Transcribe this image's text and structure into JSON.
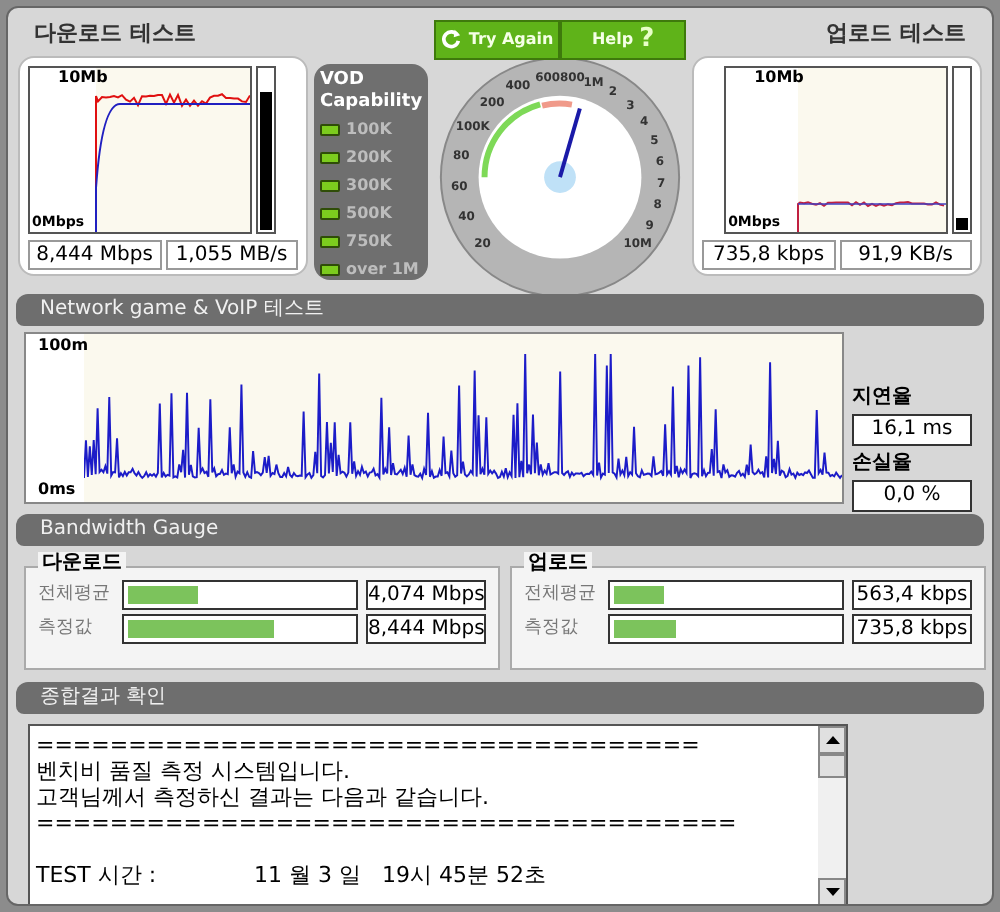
{
  "download": {
    "title": "다운로드 테스트",
    "chart_top": "10Mb",
    "chart_bottom": "0Mbps",
    "level": 0.86,
    "speed": "8,444 Mbps",
    "rate": "1,055 MB/s"
  },
  "vod": {
    "title": "VOD Capability",
    "items": [
      {
        "label": "100K",
        "on": true
      },
      {
        "label": "200K",
        "on": true
      },
      {
        "label": "300K",
        "on": true
      },
      {
        "label": "500K",
        "on": true
      },
      {
        "label": "750K",
        "on": true
      },
      {
        "label": "over 1M",
        "on": true
      }
    ]
  },
  "dial": {
    "buttons": [
      {
        "kind": "retry",
        "label": "Try Again"
      },
      {
        "kind": "help",
        "label": "Help",
        "icon": "?"
      }
    ],
    "left_labels": [
      "600",
      "400",
      "200",
      "100K",
      "80",
      "60",
      "40",
      "20"
    ],
    "right_labels": [
      "800",
      "1M",
      "2",
      "3",
      "4",
      "5",
      "6",
      "7",
      "8",
      "9",
      "10M"
    ],
    "level": 0.56
  },
  "upload": {
    "title": "업로드 테스트",
    "chart_top": "10Mb",
    "chart_bottom": "0Mbps",
    "level": 0.07,
    "speed": "735,8 kbps",
    "rate": "91,9 KB/s"
  },
  "network": {
    "title": "Network game & VoIP 테스트",
    "chart_top": "100m",
    "chart_bottom": "0ms",
    "latency_label": "지연율",
    "latency": "16,1 ms",
    "loss_label": "손실율",
    "loss": "0,0 %"
  },
  "bandwidth": {
    "title": "Bandwidth Gauge",
    "groups": [
      {
        "title": "다운로드",
        "rows": [
          {
            "label": "전체평균",
            "level": 0.31,
            "value": "4,074 Mbps"
          },
          {
            "label": "측정값",
            "level": 0.65,
            "value": "8,444 Mbps"
          }
        ]
      },
      {
        "title": "업로드",
        "rows": [
          {
            "label": "전체평균",
            "level": 0.22,
            "value": "563,4 kbps"
          },
          {
            "label": "측정값",
            "level": 0.28,
            "value": "735,8 kbps"
          }
        ]
      }
    ]
  },
  "result": {
    "title": "종합결과 확인",
    "lines": [
      "====================================",
      "벤치비 품질 측정 시스템입니다.",
      "고객님께서 측정하신 결과는 다음과 같습니다.",
      "======================================",
      "TEST 시간 :              11 월 3 일   19시 45분 52초"
    ]
  }
}
